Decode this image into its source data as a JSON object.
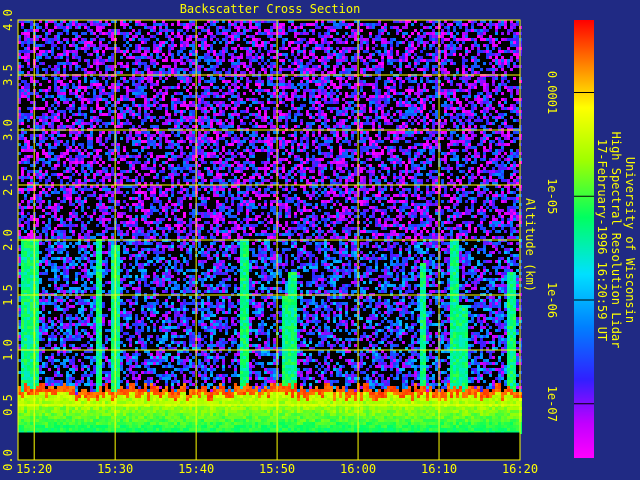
{
  "chart_data": {
    "type": "heatmap",
    "title": "Backscatter Cross Section",
    "ylabel": "Altitude (km)",
    "xlabel": "",
    "x_ticks": [
      "15:20",
      "15:30",
      "15:40",
      "15:50",
      "16:00",
      "16:10",
      "16:20"
    ],
    "y_ticks": [
      "0.0",
      "0.5",
      "1.0",
      "1.5",
      "2.0",
      "2.5",
      "3.0",
      "3.5",
      "4.0"
    ],
    "xlim": [
      "15:18",
      "16:20"
    ],
    "ylim": [
      0,
      4
    ],
    "grid": true,
    "colorbar": {
      "scale": "log",
      "ticks": [
        "0.0001",
        "1e-05",
        "1e-06",
        "1e-07"
      ],
      "range": [
        3e-08,
        0.0005
      ]
    },
    "features": {
      "boundary_layer_top_km": 0.65,
      "no_data_below_km": 0.25,
      "plumes": [
        {
          "time": "15:19",
          "top_km": 2.0
        },
        {
          "time": "15:20",
          "top_km": 2.0
        },
        {
          "time": "15:28",
          "top_km": 2.0
        },
        {
          "time": "15:30",
          "top_km": 1.95
        },
        {
          "time": "15:46",
          "top_km": 2.0
        },
        {
          "time": "15:51",
          "top_km": 1.5
        },
        {
          "time": "15:52",
          "top_km": 1.7
        },
        {
          "time": "16:08",
          "top_km": 1.8
        },
        {
          "time": "16:12",
          "top_km": 2.0
        },
        {
          "time": "16:13",
          "top_km": 1.4
        },
        {
          "time": "16:19",
          "top_km": 1.7
        }
      ]
    }
  },
  "side_label": {
    "line1": "University of Wisconsin",
    "line2": "High Spectral Resolution Lidar",
    "line3": "17-February-1996 16:20:59 UT"
  }
}
